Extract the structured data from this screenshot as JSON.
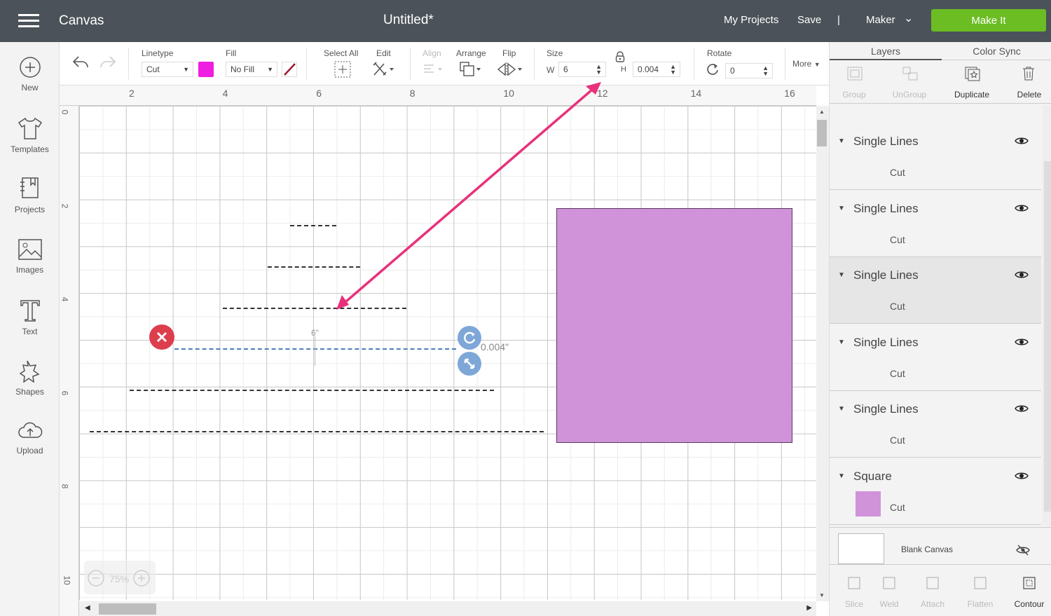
{
  "header": {
    "app": "Canvas",
    "title": "Untitled*",
    "my_projects": "My Projects",
    "save": "Save",
    "divider": "|",
    "machine": "Maker",
    "make_it": "Make It"
  },
  "nav": [
    {
      "label": "New",
      "icon": "plus-circle-icon"
    },
    {
      "label": "Templates",
      "icon": "tshirt-icon"
    },
    {
      "label": "Projects",
      "icon": "projects-icon"
    },
    {
      "label": "Images",
      "icon": "image-icon"
    },
    {
      "label": "Text",
      "icon": "text-icon"
    },
    {
      "label": "Shapes",
      "icon": "shapes-icon"
    },
    {
      "label": "Upload",
      "icon": "upload-cloud-icon"
    }
  ],
  "toolbar": {
    "linetype_label": "Linetype",
    "linetype_value": "Cut",
    "linetype_color": "#f01ee0",
    "fill_label": "Fill",
    "fill_value": "No Fill",
    "select_all": "Select All",
    "edit": "Edit",
    "align": "Align",
    "arrange": "Arrange",
    "flip": "Flip",
    "size": "Size",
    "w_label": "W",
    "w_value": "6",
    "h_label": "H",
    "h_value": "0.004",
    "rotate": "Rotate",
    "rotate_value": "0",
    "more": "More"
  },
  "ruler": {
    "top": [
      "2",
      "4",
      "6",
      "8",
      "10",
      "12",
      "14",
      "16"
    ],
    "left": [
      "0",
      "2",
      "4",
      "6",
      "8",
      "10"
    ]
  },
  "selection": {
    "width_label": "6\"",
    "height_label": "0.004\""
  },
  "zoom": {
    "value": "75%"
  },
  "panel": {
    "tabs": [
      "Layers",
      "Color Sync"
    ],
    "actions": [
      "Group",
      "UnGroup",
      "Duplicate",
      "Delete"
    ],
    "layers": [
      {
        "name": "Single Lines",
        "op": "Cut"
      },
      {
        "name": "Single Lines",
        "op": "Cut"
      },
      {
        "name": "Single Lines",
        "op": "Cut"
      },
      {
        "name": "Single Lines",
        "op": "Cut"
      },
      {
        "name": "Single Lines",
        "op": "Cut"
      },
      {
        "name": "Square",
        "op": "Cut"
      }
    ],
    "blank_canvas": "Blank Canvas",
    "bottom_actions": [
      "Slice",
      "Weld",
      "Attach",
      "Flatten",
      "Contour"
    ]
  },
  "colors": {
    "topbar": "#4b5259",
    "make_it": "#6bbd23",
    "square": "#d093da",
    "arrow": "#e8317a",
    "selection": "#4a7fc1"
  }
}
